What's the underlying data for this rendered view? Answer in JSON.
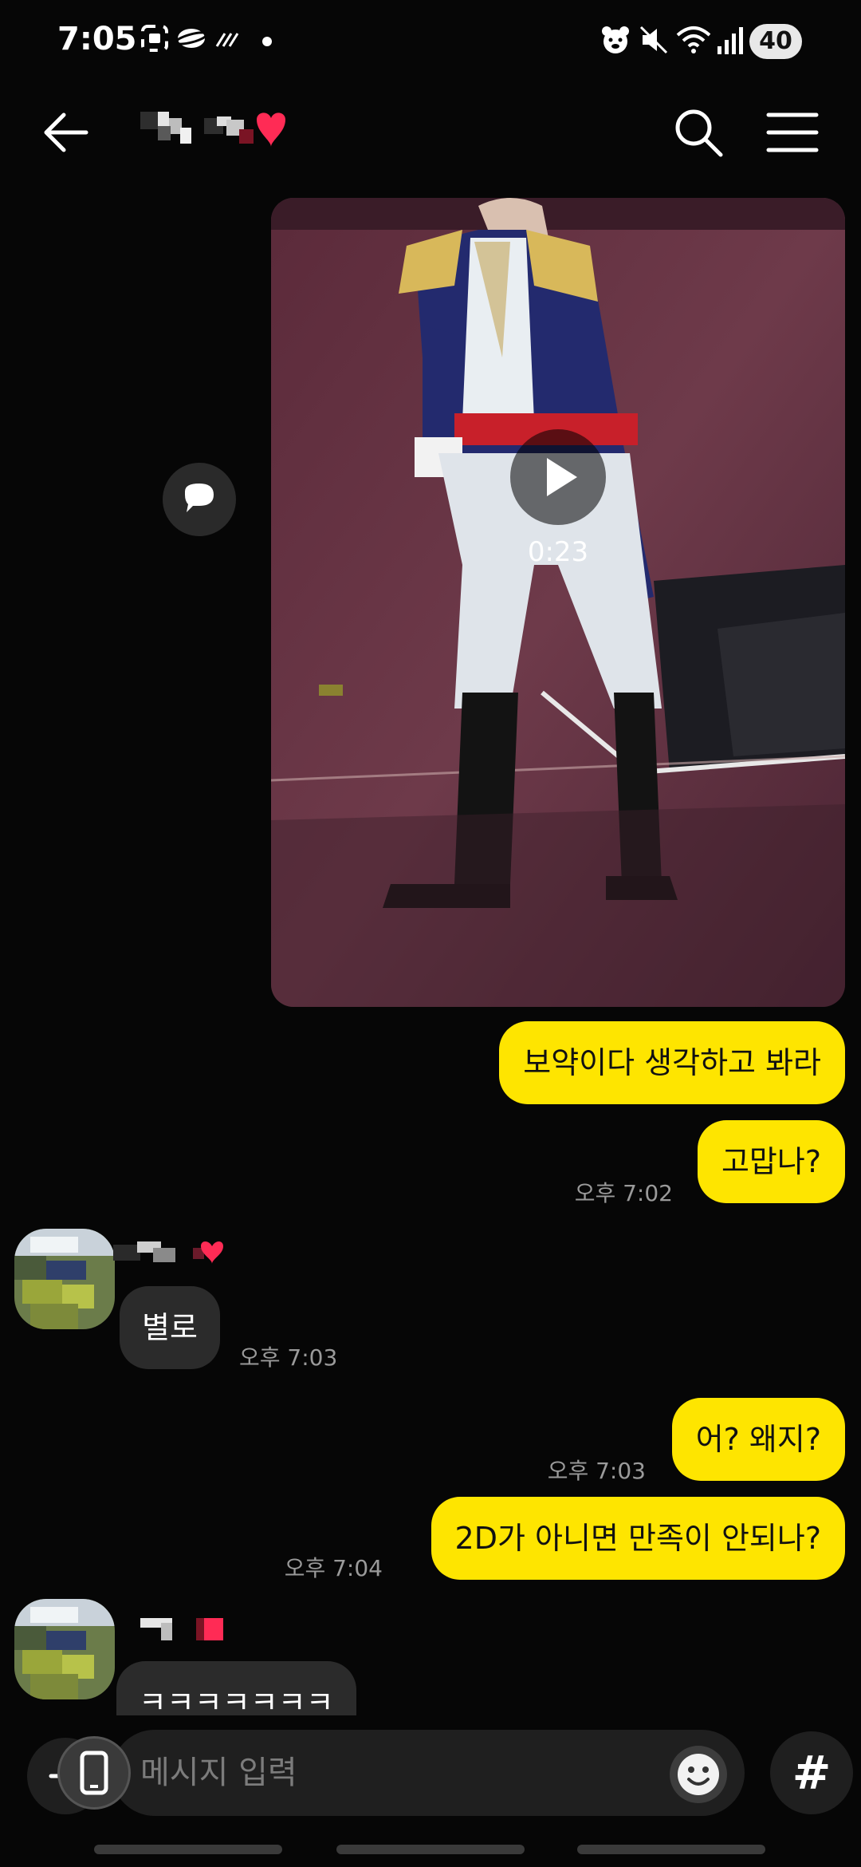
{
  "status_bar": {
    "time": "7:05",
    "battery": "40",
    "icons": [
      "screenshot-icon",
      "cloud-icon",
      "signal-noise-icon",
      "dot-icon",
      "bear-icon",
      "mute-icon",
      "wifi-icon",
      "cell-signal-icon"
    ]
  },
  "header": {
    "back_icon": "arrow-left-icon",
    "title_image": "pixelated-name-with-heart",
    "search_icon": "search-icon",
    "menu_icon": "hamburger-icon"
  },
  "media": {
    "duration": "0:23",
    "play_icon": "play-icon",
    "share_icon": "speech-bubble-icon"
  },
  "messages": [
    {
      "side": "me",
      "text": "보약이다 생각하고 봐라"
    },
    {
      "side": "me",
      "text": "고맙나?",
      "time": "오후 7:02"
    },
    {
      "side": "other",
      "text": "별로",
      "time": "오후 7:03"
    },
    {
      "side": "me",
      "text": "어? 왜지?",
      "time": "오후 7:03"
    },
    {
      "side": "me",
      "text": "2D가 아니면 만족이 안되나?",
      "time": "오후 7:04"
    },
    {
      "side": "other",
      "text": "ㅋㅋㅋㅋㅋㅋㅋ"
    }
  ],
  "input": {
    "placeholder": "메시지 입력",
    "hashtag": "#"
  },
  "colors": {
    "background": "#060606",
    "my_bubble": "#fee500",
    "other_bubble": "#2b2b2b",
    "timestamp": "#9a9a9a"
  }
}
